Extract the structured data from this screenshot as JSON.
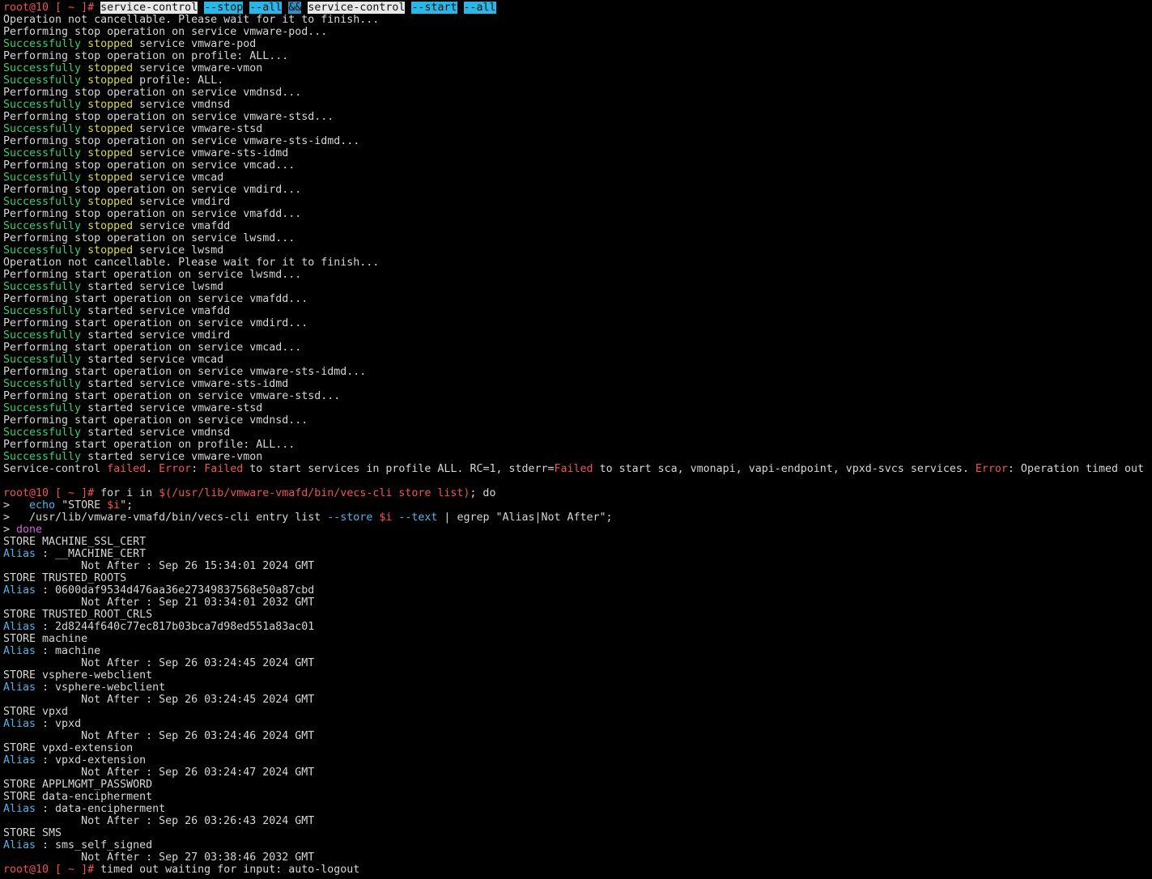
{
  "terminal": {
    "lines": [
      [
        [
          "root@10 [ ~ ]# ",
          "prompt"
        ],
        [
          "service-control",
          "sel"
        ],
        [
          " ",
          ""
        ],
        [
          "--stop",
          "sel-cy"
        ],
        [
          " ",
          ""
        ],
        [
          "--all",
          "sel-cy"
        ],
        [
          " ",
          ""
        ],
        [
          "&&",
          "sel-dk"
        ],
        [
          " ",
          ""
        ],
        [
          "service-control",
          "sel"
        ],
        [
          " ",
          ""
        ],
        [
          "--start",
          "sel-cy"
        ],
        [
          " ",
          ""
        ],
        [
          "--all",
          "sel-cy"
        ]
      ],
      [
        [
          "Operation not cancellable. Please wait for it to finish...",
          ""
        ]
      ],
      [
        [
          "Performing stop operation on service vmware-pod...",
          ""
        ]
      ],
      [
        [
          "Successfully ",
          "green"
        ],
        [
          "stopped",
          "yellow"
        ],
        [
          " service vmware-pod",
          ""
        ]
      ],
      [
        [
          "Performing stop operation on profile: ALL...",
          ""
        ]
      ],
      [
        [
          "Successfully ",
          "green"
        ],
        [
          "stopped",
          "yellow"
        ],
        [
          " service vmware-vmon",
          ""
        ]
      ],
      [
        [
          "Successfully ",
          "green"
        ],
        [
          "stopped",
          "yellow"
        ],
        [
          " profile: ALL.",
          ""
        ]
      ],
      [
        [
          "Performing stop operation on service vmdnsd...",
          ""
        ]
      ],
      [
        [
          "Successfully ",
          "green"
        ],
        [
          "stopped",
          "yellow"
        ],
        [
          " service vmdnsd",
          ""
        ]
      ],
      [
        [
          "Performing stop operation on service vmware-stsd...",
          ""
        ]
      ],
      [
        [
          "Successfully ",
          "green"
        ],
        [
          "stopped",
          "yellow"
        ],
        [
          " service vmware-stsd",
          ""
        ]
      ],
      [
        [
          "Performing stop operation on service vmware-sts-idmd...",
          ""
        ]
      ],
      [
        [
          "Successfully ",
          "green"
        ],
        [
          "stopped",
          "yellow"
        ],
        [
          " service vmware-sts-idmd",
          ""
        ]
      ],
      [
        [
          "Performing stop operation on service vmcad...",
          ""
        ]
      ],
      [
        [
          "Successfully ",
          "green"
        ],
        [
          "stopped",
          "yellow"
        ],
        [
          " service vmcad",
          ""
        ]
      ],
      [
        [
          "Performing stop operation on service vmdird...",
          ""
        ]
      ],
      [
        [
          "Successfully ",
          "green"
        ],
        [
          "stopped",
          "yellow"
        ],
        [
          " service vmdird",
          ""
        ]
      ],
      [
        [
          "Performing stop operation on service vmafdd...",
          ""
        ]
      ],
      [
        [
          "Successfully ",
          "green"
        ],
        [
          "stopped",
          "yellow"
        ],
        [
          " service vmafdd",
          ""
        ]
      ],
      [
        [
          "Performing stop operation on service lwsmd...",
          ""
        ]
      ],
      [
        [
          "Successfully ",
          "green"
        ],
        [
          "stopped",
          "yellow"
        ],
        [
          " service lwsmd",
          ""
        ]
      ],
      [
        [
          "Operation not cancellable. Please wait for it to finish...",
          ""
        ]
      ],
      [
        [
          "Performing start operation on service lwsmd...",
          ""
        ]
      ],
      [
        [
          "Successfully ",
          "green"
        ],
        [
          "started service lwsmd",
          ""
        ]
      ],
      [
        [
          "Performing start operation on service vmafdd...",
          ""
        ]
      ],
      [
        [
          "Successfully ",
          "green"
        ],
        [
          "started service vmafdd",
          ""
        ]
      ],
      [
        [
          "Performing start operation on service vmdird...",
          ""
        ]
      ],
      [
        [
          "Successfully ",
          "green"
        ],
        [
          "started service vmdird",
          ""
        ]
      ],
      [
        [
          "Performing start operation on service vmcad...",
          ""
        ]
      ],
      [
        [
          "Successfully ",
          "green"
        ],
        [
          "started service vmcad",
          ""
        ]
      ],
      [
        [
          "Performing start operation on service vmware-sts-idmd...",
          ""
        ]
      ],
      [
        [
          "Successfully ",
          "green"
        ],
        [
          "started service vmware-sts-idmd",
          ""
        ]
      ],
      [
        [
          "Performing start operation on service vmware-stsd...",
          ""
        ]
      ],
      [
        [
          "Successfully ",
          "green"
        ],
        [
          "started service vmware-stsd",
          ""
        ]
      ],
      [
        [
          "Performing start operation on service vmdnsd...",
          ""
        ]
      ],
      [
        [
          "Successfully ",
          "green"
        ],
        [
          "started service vmdnsd",
          ""
        ]
      ],
      [
        [
          "Performing start operation on profile: ALL...",
          ""
        ]
      ],
      [
        [
          "Successfully ",
          "green"
        ],
        [
          "started service vmware-vmon",
          ""
        ]
      ],
      [
        [
          "Service-control ",
          ""
        ],
        [
          "failed",
          "red"
        ],
        [
          ". ",
          ""
        ],
        [
          "Error",
          "red"
        ],
        [
          ": ",
          ""
        ],
        [
          "Failed",
          "red"
        ],
        [
          " to start services in profile ALL. RC=1, stderr=",
          ""
        ],
        [
          "Failed",
          "red"
        ],
        [
          " to start sca, vmonapi, vapi-endpoint, vpxd-svcs services. ",
          ""
        ],
        [
          "Error",
          "red"
        ],
        [
          ": Operation timed out",
          ""
        ]
      ],
      [],
      [
        [
          "root@10 [ ~ ]# ",
          "prompt"
        ],
        [
          "for i in ",
          ""
        ],
        [
          "$(/usr/lib/vmware-vmafd/bin/vecs-cli store list)",
          "red"
        ],
        [
          "; do",
          ""
        ]
      ],
      [
        [
          ">   ",
          ""
        ],
        [
          "echo",
          "blue"
        ],
        [
          " \"STORE ",
          ""
        ],
        [
          "$i",
          "red"
        ],
        [
          "\";",
          ""
        ]
      ],
      [
        [
          ">   /usr/lib/vmware-vmafd/bin/vecs-cli entry list ",
          ""
        ],
        [
          "--store",
          "blue"
        ],
        [
          " ",
          ""
        ],
        [
          "$i",
          "red"
        ],
        [
          " ",
          ""
        ],
        [
          "--text",
          "blue"
        ],
        [
          " | egrep \"Alias|Not After\";",
          ""
        ]
      ],
      [
        [
          "> ",
          ""
        ],
        [
          "done",
          "magenta"
        ]
      ],
      [
        [
          "STORE MACHINE_SSL_CERT",
          ""
        ]
      ],
      [
        [
          "Alias",
          "blue"
        ],
        [
          " : __MACHINE_CERT",
          ""
        ]
      ],
      [
        [
          "            Not After : Sep 26 15:34:01 2024 GMT",
          ""
        ]
      ],
      [
        [
          "STORE TRUSTED_ROOTS",
          ""
        ]
      ],
      [
        [
          "Alias",
          "blue"
        ],
        [
          " : 0600daf9534d476aa36e27349837568e50a87cbd",
          ""
        ]
      ],
      [
        [
          "            Not After : Sep 21 03:34:01 2032 GMT",
          ""
        ]
      ],
      [
        [
          "STORE TRUSTED_ROOT_CRLS",
          ""
        ]
      ],
      [
        [
          "Alias",
          "blue"
        ],
        [
          " : 2d8244f640c77ec817b03bca7d98ed551a83ac01",
          ""
        ]
      ],
      [
        [
          "STORE machine",
          ""
        ]
      ],
      [
        [
          "Alias",
          "blue"
        ],
        [
          " : machine",
          ""
        ]
      ],
      [
        [
          "            Not After : Sep 26 03:24:45 2024 GMT",
          ""
        ]
      ],
      [
        [
          "STORE vsphere-webclient",
          ""
        ]
      ],
      [
        [
          "Alias",
          "blue"
        ],
        [
          " : vsphere-webclient",
          ""
        ]
      ],
      [
        [
          "            Not After : Sep 26 03:24:45 2024 GMT",
          ""
        ]
      ],
      [
        [
          "STORE vpxd",
          ""
        ]
      ],
      [
        [
          "Alias",
          "blue"
        ],
        [
          " : vpxd",
          ""
        ]
      ],
      [
        [
          "            Not After : Sep 26 03:24:46 2024 GMT",
          ""
        ]
      ],
      [
        [
          "STORE vpxd-extension",
          ""
        ]
      ],
      [
        [
          "Alias",
          "blue"
        ],
        [
          " : vpxd-extension",
          ""
        ]
      ],
      [
        [
          "            Not After : Sep 26 03:24:47 2024 GMT",
          ""
        ]
      ],
      [
        [
          "STORE APPLMGMT_PASSWORD",
          ""
        ]
      ],
      [
        [
          "STORE data-encipherment",
          ""
        ]
      ],
      [
        [
          "Alias",
          "blue"
        ],
        [
          " : data-encipherment",
          ""
        ]
      ],
      [
        [
          "            Not After : Sep 26 03:26:43 2024 GMT",
          ""
        ]
      ],
      [
        [
          "STORE SMS",
          ""
        ]
      ],
      [
        [
          "Alias",
          "blue"
        ],
        [
          " : sms_self_signed",
          ""
        ]
      ],
      [
        [
          "            Not After : Sep 27 03:38:46 2032 GMT",
          ""
        ]
      ],
      [
        [
          "root@10 [ ~ ]# ",
          "prompt"
        ],
        [
          "timed out waiting for input: auto-logout",
          ""
        ]
      ]
    ]
  }
}
